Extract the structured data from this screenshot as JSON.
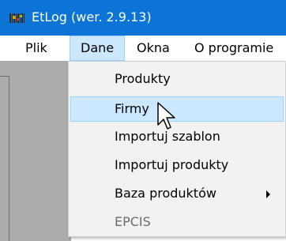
{
  "window": {
    "title": "EtLog (wer. 2.9.13)",
    "app_icon": "app-logo-icon",
    "titlebar_color": "#0b74d6"
  },
  "menubar": {
    "items": [
      {
        "label": "Plik"
      },
      {
        "label": "Dane",
        "active": true
      },
      {
        "label": "Okna"
      },
      {
        "label": "O programie"
      }
    ]
  },
  "dropdown": {
    "items": [
      {
        "label": "Produkty"
      },
      {
        "label": "Firmy",
        "highlighted": true
      },
      {
        "label": "Importuj szablon"
      },
      {
        "label": "Importuj produkty"
      },
      {
        "label": "Baza produktów",
        "has_submenu": true
      },
      {
        "label": "EPCIS",
        "disabled": true
      }
    ],
    "highlight_color": "#cce8ff"
  },
  "cursor": "pointer-arrow-icon"
}
